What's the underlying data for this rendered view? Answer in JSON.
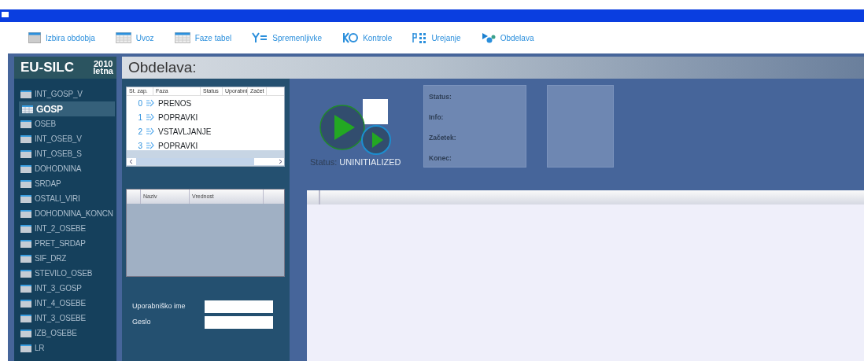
{
  "toolbar": [
    {
      "label": "Izbira obdobja",
      "kind": "calendar"
    },
    {
      "label": "Uvoz",
      "kind": "grid"
    },
    {
      "label": "Faze tabel",
      "kind": "grid"
    },
    {
      "label": "Spremenljivke",
      "kind": "y"
    },
    {
      "label": "Kontrole",
      "kind": "ko"
    },
    {
      "label": "Urejanje",
      "kind": "edit"
    },
    {
      "label": "Obdelava",
      "kind": "process"
    }
  ],
  "brand": {
    "name": "EU-SILC",
    "year": "2010",
    "period": "letna"
  },
  "page_title": "Obdelava:",
  "sidebar": {
    "items": [
      {
        "label": "INT_GOSP_V",
        "selected": false
      },
      {
        "label": "GOSP",
        "selected": true
      },
      {
        "label": "OSEB",
        "selected": false
      },
      {
        "label": "INT_OSEB_V",
        "selected": false
      },
      {
        "label": "INT_OSEB_S",
        "selected": false
      },
      {
        "label": "DOHODNINA",
        "selected": false
      },
      {
        "label": "SRDAP",
        "selected": false
      },
      {
        "label": "OSTALI_VIRI",
        "selected": false
      },
      {
        "label": "DOHODNINA_KONCN",
        "selected": false
      },
      {
        "label": "INT_2_OSEBE",
        "selected": false
      },
      {
        "label": "PRET_SRDAP",
        "selected": false
      },
      {
        "label": "SIF_DRZ",
        "selected": false
      },
      {
        "label": "STEVILO_OSEB",
        "selected": false
      },
      {
        "label": "INT_3_GOSP",
        "selected": false
      },
      {
        "label": "INT_4_OSEBE",
        "selected": false
      },
      {
        "label": "INT_3_OSEBE",
        "selected": false
      },
      {
        "label": "IZB_OSEBE",
        "selected": false
      },
      {
        "label": "LR",
        "selected": false
      }
    ]
  },
  "phases": {
    "columns": [
      "St. zap.",
      "Faza",
      "Status",
      "Uporabni",
      "Začet"
    ],
    "rows": [
      {
        "index": "0",
        "phase": "PRENOS"
      },
      {
        "index": "1",
        "phase": "POPRAVKI"
      },
      {
        "index": "2",
        "phase": "VSTAVLJANJE"
      },
      {
        "index": "3",
        "phase": "POPRAVKI"
      }
    ]
  },
  "parameters": {
    "columns": [
      "Naziv",
      "Vrednost"
    ]
  },
  "login": {
    "fields": [
      {
        "label": "Uporabniško ime"
      },
      {
        "label": "Geslo"
      }
    ]
  },
  "run_status": {
    "label": "Status:",
    "value": "UNINITIALIZED"
  },
  "info_panel": {
    "labels": [
      "Status:",
      "Info:",
      "Začetek:",
      "Konec:"
    ]
  }
}
